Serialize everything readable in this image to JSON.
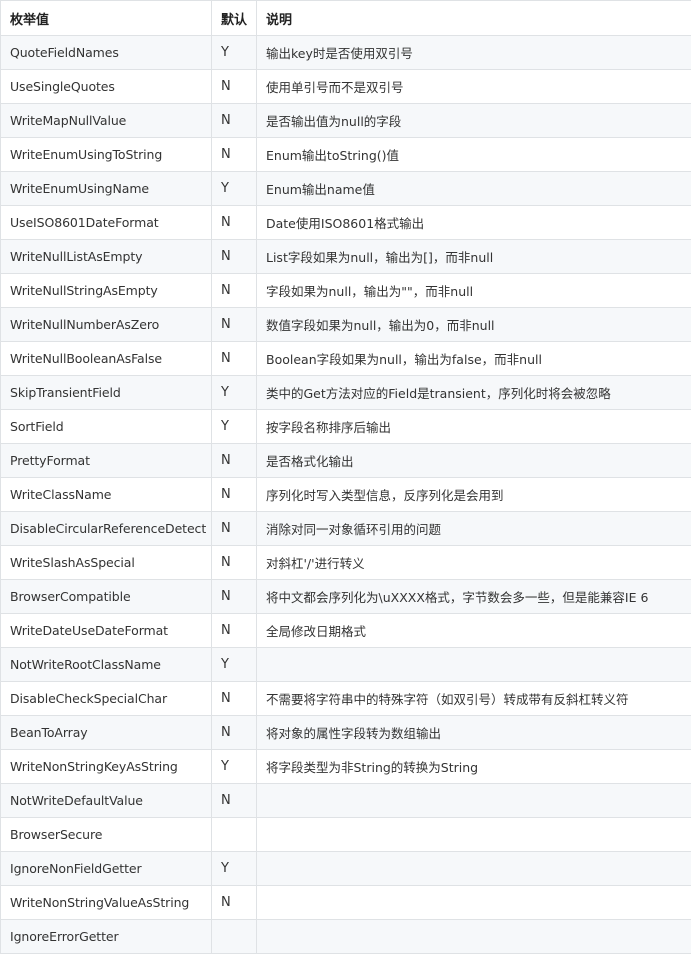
{
  "table": {
    "headers": [
      "枚举值",
      "默认",
      "说明"
    ],
    "rows": [
      {
        "name": "QuoteFieldNames",
        "default": "Y",
        "desc": "输出key时是否使用双引号"
      },
      {
        "name": "UseSingleQuotes",
        "default": "N",
        "desc": "使用单引号而不是双引号"
      },
      {
        "name": "WriteMapNullValue",
        "default": "N",
        "desc": "是否输出值为null的字段"
      },
      {
        "name": "WriteEnumUsingToString",
        "default": "N",
        "desc": "Enum输出toString()值"
      },
      {
        "name": "WriteEnumUsingName",
        "default": "Y",
        "desc": "Enum输出name值"
      },
      {
        "name": "UseISO8601DateFormat",
        "default": "N",
        "desc": "Date使用ISO8601格式输出"
      },
      {
        "name": "WriteNullListAsEmpty",
        "default": "N",
        "desc": "List字段如果为null，输出为[]，而非null"
      },
      {
        "name": "WriteNullStringAsEmpty",
        "default": "N",
        "desc": "字段如果为null，输出为\"\"，而非null"
      },
      {
        "name": "WriteNullNumberAsZero",
        "default": "N",
        "desc": "数值字段如果为null，输出为0，而非null"
      },
      {
        "name": "WriteNullBooleanAsFalse",
        "default": "N",
        "desc": "Boolean字段如果为null，输出为false，而非null"
      },
      {
        "name": "SkipTransientField",
        "default": "Y",
        "desc": "类中的Get方法对应的Field是transient，序列化时将会被忽略"
      },
      {
        "name": "SortField",
        "default": "Y",
        "desc": "按字段名称排序后输出"
      },
      {
        "name": "PrettyFormat",
        "default": "N",
        "desc": "是否格式化输出"
      },
      {
        "name": "WriteClassName",
        "default": "N",
        "desc": "序列化时写入类型信息，反序列化是会用到"
      },
      {
        "name": "DisableCircularReferenceDetect",
        "default": "N",
        "desc": "消除对同一对象循环引用的问题"
      },
      {
        "name": "WriteSlashAsSpecial",
        "default": "N",
        "desc": "对斜杠'/'进行转义"
      },
      {
        "name": "BrowserCompatible",
        "default": "N",
        "desc": "将中文都会序列化为\\uXXXX格式，字节数会多一些，但是能兼容IE 6"
      },
      {
        "name": "WriteDateUseDateFormat",
        "default": "N",
        "desc": "全局修改日期格式"
      },
      {
        "name": "NotWriteRootClassName",
        "default": "Y",
        "desc": ""
      },
      {
        "name": "DisableCheckSpecialChar",
        "default": "N",
        "desc": "不需要将字符串中的特殊字符（如双引号）转成带有反斜杠转义符"
      },
      {
        "name": "BeanToArray",
        "default": "N",
        "desc": "将对象的属性字段转为数组输出"
      },
      {
        "name": "WriteNonStringKeyAsString",
        "default": "Y",
        "desc": "将字段类型为非String的转换为String"
      },
      {
        "name": "NotWriteDefaultValue",
        "default": "N",
        "desc": ""
      },
      {
        "name": "BrowserSecure",
        "default": "",
        "desc": ""
      },
      {
        "name": "IgnoreNonFieldGetter",
        "default": "Y",
        "desc": ""
      },
      {
        "name": "WriteNonStringValueAsString",
        "default": "N",
        "desc": ""
      },
      {
        "name": "IgnoreErrorGetter",
        "default": "",
        "desc": ""
      }
    ]
  }
}
